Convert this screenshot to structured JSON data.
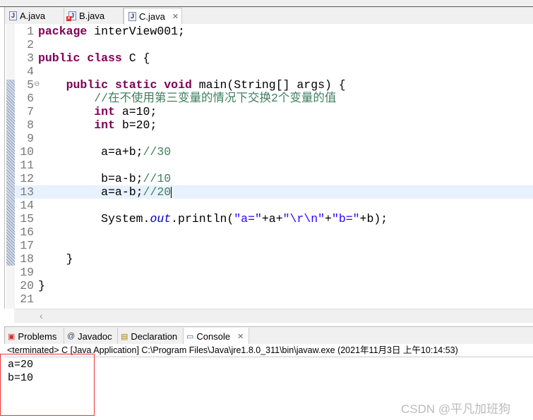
{
  "editor_tabs": [
    {
      "label": "A.java",
      "error": false
    },
    {
      "label": "B.java",
      "error": true
    },
    {
      "label": "C.java",
      "active": true
    }
  ],
  "code_lines": [
    [
      [
        "package",
        "kw"
      ],
      [
        " interView001;",
        ""
      ]
    ],
    [],
    [
      [
        "public",
        "kw"
      ],
      [
        " ",
        ""
      ],
      [
        "class",
        "kw"
      ],
      [
        " C {",
        ""
      ]
    ],
    [],
    [
      [
        "    ",
        ""
      ],
      [
        "public",
        "kw"
      ],
      [
        " ",
        ""
      ],
      [
        "static",
        "kw"
      ],
      [
        " ",
        ""
      ],
      [
        "void",
        "kw"
      ],
      [
        " main(String[] args) {",
        ""
      ]
    ],
    [
      [
        "        ",
        ""
      ],
      [
        "//在不使用第三变量的情况下交换2个变量的值",
        "cm"
      ]
    ],
    [
      [
        "        ",
        ""
      ],
      [
        "int",
        "kw"
      ],
      [
        " a=10;",
        ""
      ]
    ],
    [
      [
        "        ",
        ""
      ],
      [
        "int",
        "kw"
      ],
      [
        " b=20;",
        ""
      ]
    ],
    [],
    [
      [
        "         a=a+b;",
        ""
      ],
      [
        "//30",
        "cm"
      ]
    ],
    [],
    [
      [
        "         b=a-b;",
        ""
      ],
      [
        "//10",
        "cm"
      ]
    ],
    [
      [
        "         a=a-b;",
        ""
      ],
      [
        "//20",
        "cm"
      ]
    ],
    [],
    [
      [
        "         System.",
        ""
      ],
      [
        "out",
        "fd"
      ],
      [
        ".println(",
        ""
      ],
      [
        "\"a=\"",
        "st"
      ],
      [
        "+a+",
        ""
      ],
      [
        "\"\\r\\n\"",
        "st"
      ],
      [
        "+",
        ""
      ],
      [
        "\"b=\"",
        "st"
      ],
      [
        "+b);",
        ""
      ]
    ],
    [],
    [],
    [
      [
        "    }",
        ""
      ]
    ],
    [],
    [
      [
        "}",
        ""
      ]
    ],
    []
  ],
  "current_line": 13,
  "bottom_tabs": [
    {
      "label": "Problems",
      "icon": "problems-icon"
    },
    {
      "label": "Javadoc",
      "icon": "at-icon"
    },
    {
      "label": "Declaration",
      "icon": "declaration-icon"
    },
    {
      "label": "Console",
      "icon": "console-icon",
      "active": true
    }
  ],
  "console": {
    "status": "<terminated> C [Java Application] C:\\Program Files\\Java\\jre1.8.0_311\\bin\\javaw.exe (2021年11月3日 上午10:14:53)",
    "output": [
      "a=20",
      "b=10"
    ]
  },
  "watermark": "CSDN @平凡加班狗"
}
